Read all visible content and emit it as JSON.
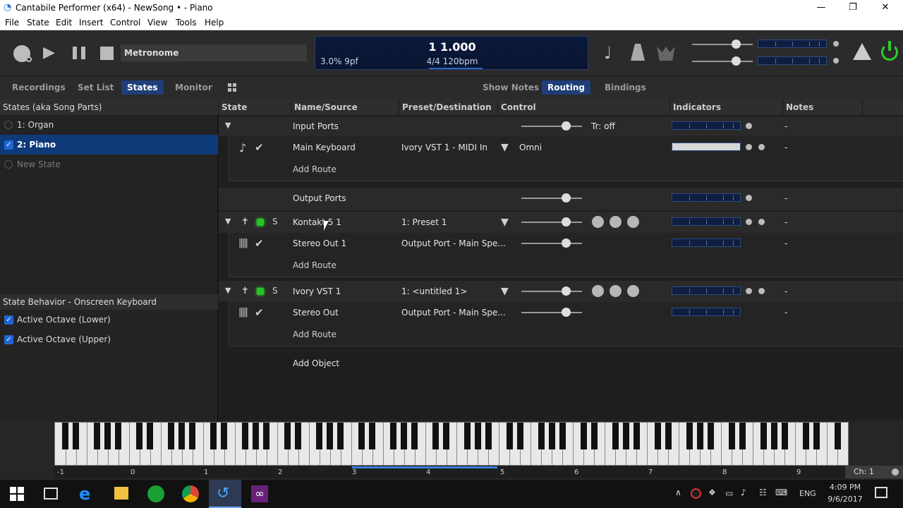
{
  "window": {
    "title": "Cantabile Performer (x64) - NewSong • - Piano"
  },
  "menu": [
    "File",
    "State",
    "Edit",
    "Insert",
    "Control",
    "View",
    "Tools",
    "Help"
  ],
  "transport": {
    "metronome_label": "Metronome",
    "position": "1 1.000",
    "tempo": "4/4 120bpm",
    "cpu": "3.0%  9pf"
  },
  "left_tabs": [
    "Recordings",
    "Set List",
    "States",
    "Monitor"
  ],
  "right_tabs": [
    "Show Notes",
    "Routing",
    "Bindings"
  ],
  "states_panel": {
    "header": "States (aka Song Parts)",
    "items": [
      {
        "label": "1: Organ",
        "checked": false
      },
      {
        "label": "2: Piano",
        "checked": true
      },
      {
        "label": "New State",
        "checked": false
      }
    ]
  },
  "behavior_panel": {
    "header": "State Behavior - Onscreen Keyboard",
    "items": [
      "Active Octave (Lower)",
      "Active Octave (Upper)"
    ]
  },
  "columns": [
    "State",
    "Name/Source",
    "Preset/Destination",
    "Control",
    "Indicators",
    "Notes"
  ],
  "rows": {
    "input_ports": {
      "name": "Input Ports",
      "control": "Tr: off",
      "notes": "-"
    },
    "main_keyboard": {
      "name": "Main Keyboard",
      "preset": "Ivory VST 1 - MIDI In",
      "control": "Omni",
      "notes": "-"
    },
    "add_route_1": "Add Route",
    "output_ports": {
      "name": "Output Ports",
      "notes": "-"
    },
    "kontakt": {
      "name": "Kontakt 5 1",
      "preset": "1: Preset 1",
      "notes": "-"
    },
    "stereo_out_1": {
      "name": "Stereo Out 1",
      "preset": "Output Port - Main Spe...",
      "notes": "-"
    },
    "add_route_2": "Add Route",
    "ivory": {
      "name": "Ivory VST 1",
      "preset": "1: <untitled 1>",
      "notes": "-"
    },
    "stereo_out": {
      "name": "Stereo Out",
      "preset": "Output Port - Main Spe...",
      "notes": "-"
    },
    "add_route_3": "Add Route",
    "add_object": "Add Object"
  },
  "keyboard": {
    "octaves": [
      "-1",
      "0",
      "1",
      "2",
      "3",
      "4",
      "5",
      "6",
      "7",
      "8",
      "9"
    ],
    "channel": "Ch: 1"
  },
  "taskbar": {
    "lang": "ENG",
    "time": "4:09 PM",
    "date": "9/6/2017"
  }
}
